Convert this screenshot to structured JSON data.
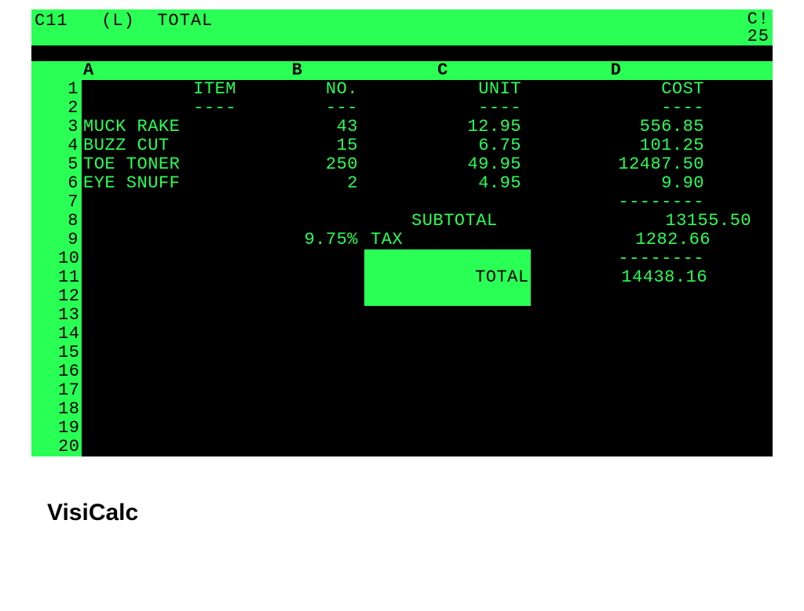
{
  "status": {
    "cell_ref": "C11",
    "format": "(L)",
    "content": "TOTAL",
    "right_top": "C!",
    "right_bottom": "25"
  },
  "columns": [
    "A",
    "B",
    "C",
    "D"
  ],
  "headers": {
    "A": "ITEM",
    "B": "NO.",
    "C": "UNIT",
    "D": "COST"
  },
  "dashes": {
    "A": "----",
    "B": "---",
    "C": "----",
    "D": "----"
  },
  "rows": {
    "3": {
      "A": "MUCK RAKE",
      "B": "43",
      "C": "12.95",
      "D": "556.85"
    },
    "4": {
      "A": "BUZZ CUT",
      "B": "15",
      "C": "6.75",
      "D": "101.25"
    },
    "5": {
      "A": "TOE TONER",
      "B": "250",
      "C": "49.95",
      "D": "12487.50"
    },
    "6": {
      "A": "EYE SNUFF",
      "B": "2",
      "C": "4.95",
      "D": "9.90"
    }
  },
  "sep7": "--------",
  "subtotal": {
    "label": "SUBTOTAL",
    "value": "13155.50"
  },
  "tax": {
    "pct": "9.75%",
    "label": "TAX",
    "value": "1282.66"
  },
  "sep10": "--------",
  "total": {
    "label": "TOTAL",
    "value": "14438.16"
  },
  "caption": "VisiCalc",
  "row_numbers": [
    "1",
    "2",
    "3",
    "4",
    "5",
    "6",
    "7",
    "8",
    "9",
    "10",
    "11",
    "12",
    "13",
    "14",
    "15",
    "16",
    "17",
    "18",
    "19",
    "20"
  ]
}
